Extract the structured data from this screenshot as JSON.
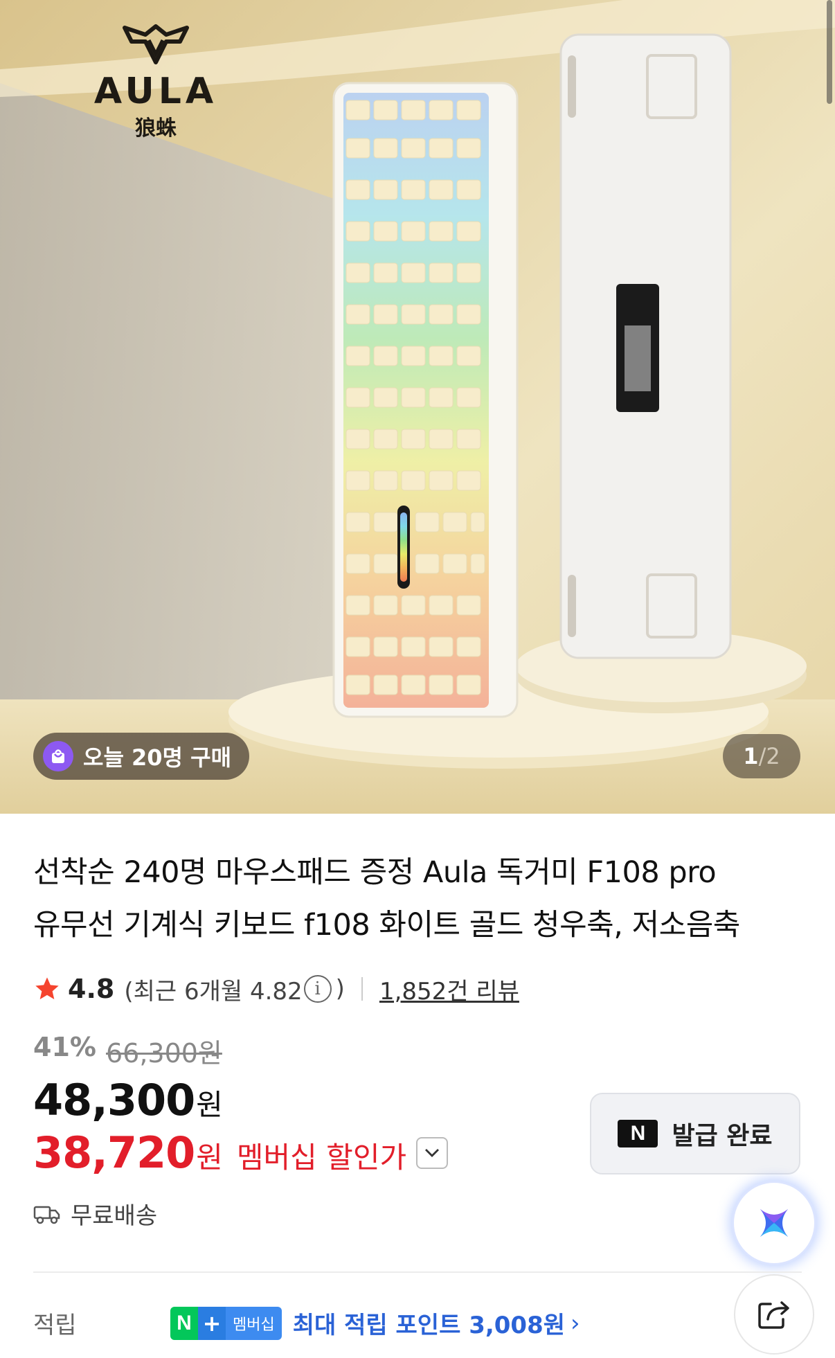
{
  "hero": {
    "brand_name": "AULA",
    "brand_sub": "狼蛛",
    "buyers_badge": "오늘 20명 구매",
    "pager": {
      "current": "1",
      "separator": "/",
      "total": "2"
    }
  },
  "product": {
    "title_line1": "선착순 240명 마우스패드 증정 Aula 독거미 F108 pro",
    "title_line2": "유무선 기계식 키보드 f108 화이트 골드 청우축, 저소음축",
    "rating": {
      "score": "4.8",
      "recent_prefix": "(최근 6개월 4.82",
      "recent_suffix": ")",
      "reviews": "1,852건 리뷰"
    },
    "discount_percent": "41%",
    "original_price": "66,300원",
    "price": "48,300",
    "price_unit": "원",
    "member_price": "38,720",
    "member_price_unit": "원",
    "member_label": "멤버십 할인가",
    "coupon_button": "발급 완료",
    "coupon_logo": "N",
    "shipping": "무료배송",
    "points": {
      "label": "적립",
      "badge_n": "N",
      "badge_plus": "+",
      "badge_membership": "멤버십",
      "text": "최대 적립 포인트 3,008원",
      "arrow": "›"
    }
  },
  "colors": {
    "sale_red": "#e21e2a",
    "naver_green": "#03c75a",
    "points_blue": "#2a62d6",
    "purple_badge": "#8d59f2"
  },
  "icons": [
    "shopping-bag-icon",
    "star-icon",
    "info-icon",
    "chevron-down-icon",
    "truck-icon",
    "ai-assistant-icon",
    "share-icon",
    "chevron-right-icon"
  ]
}
